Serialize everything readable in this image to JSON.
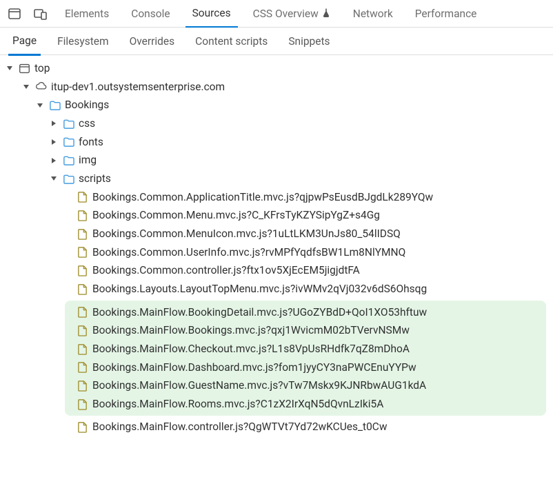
{
  "topTabs": {
    "elements": "Elements",
    "console": "Console",
    "sources": "Sources",
    "cssOverview": "CSS Overview",
    "network": "Network",
    "performance": "Performance"
  },
  "subTabs": {
    "page": "Page",
    "filesystem": "Filesystem",
    "overrides": "Overrides",
    "contentScripts": "Content scripts",
    "snippets": "Snippets"
  },
  "tree": {
    "top": "top",
    "domain": "itup-dev1.outsystemsenterprise.com",
    "app": "Bookings",
    "folders": {
      "css": "css",
      "fonts": "fonts",
      "img": "img",
      "scripts": "scripts"
    },
    "files_before": [
      "Bookings.Common.ApplicationTitle.mvc.js?qjpwPsEusdBJgdLk289YQw",
      "Bookings.Common.Menu.mvc.js?C_KFrsTyKZYSipYgZ+s4Gg",
      "Bookings.Common.MenuIcon.mvc.js?1uLtLKM3UnJs80_54lIDSQ",
      "Bookings.Common.UserInfo.mvc.js?rvMPfYqdfsBW1Lm8NlYMNQ",
      "Bookings.Common.controller.js?ftx1ov5XjEcEM5jigjdtFA",
      "Bookings.Layouts.LayoutTopMenu.mvc.js?ivWMv2qVj032v6dS6Ohsqg"
    ],
    "files_highlight": [
      "Bookings.MainFlow.BookingDetail.mvc.js?UGoZYBdD+QoI1XO53hftuw",
      "Bookings.MainFlow.Bookings.mvc.js?qxj1WvicmM02bTVervNSMw",
      "Bookings.MainFlow.Checkout.mvc.js?L1s8VpUsRHdfk7qZ8mDhoA",
      "Bookings.MainFlow.Dashboard.mvc.js?fom1jyyCY3naPWCEnuYYPw",
      "Bookings.MainFlow.GuestName.mvc.js?vTw7Mskx9KJNRbwAUG1kdA",
      "Bookings.MainFlow.Rooms.mvc.js?C1zX2IrXqN5dQvnLzIki5A"
    ],
    "files_after": [
      "Bookings.MainFlow.controller.js?QgWTVt7Yd72wKCUes_t0Cw"
    ]
  }
}
